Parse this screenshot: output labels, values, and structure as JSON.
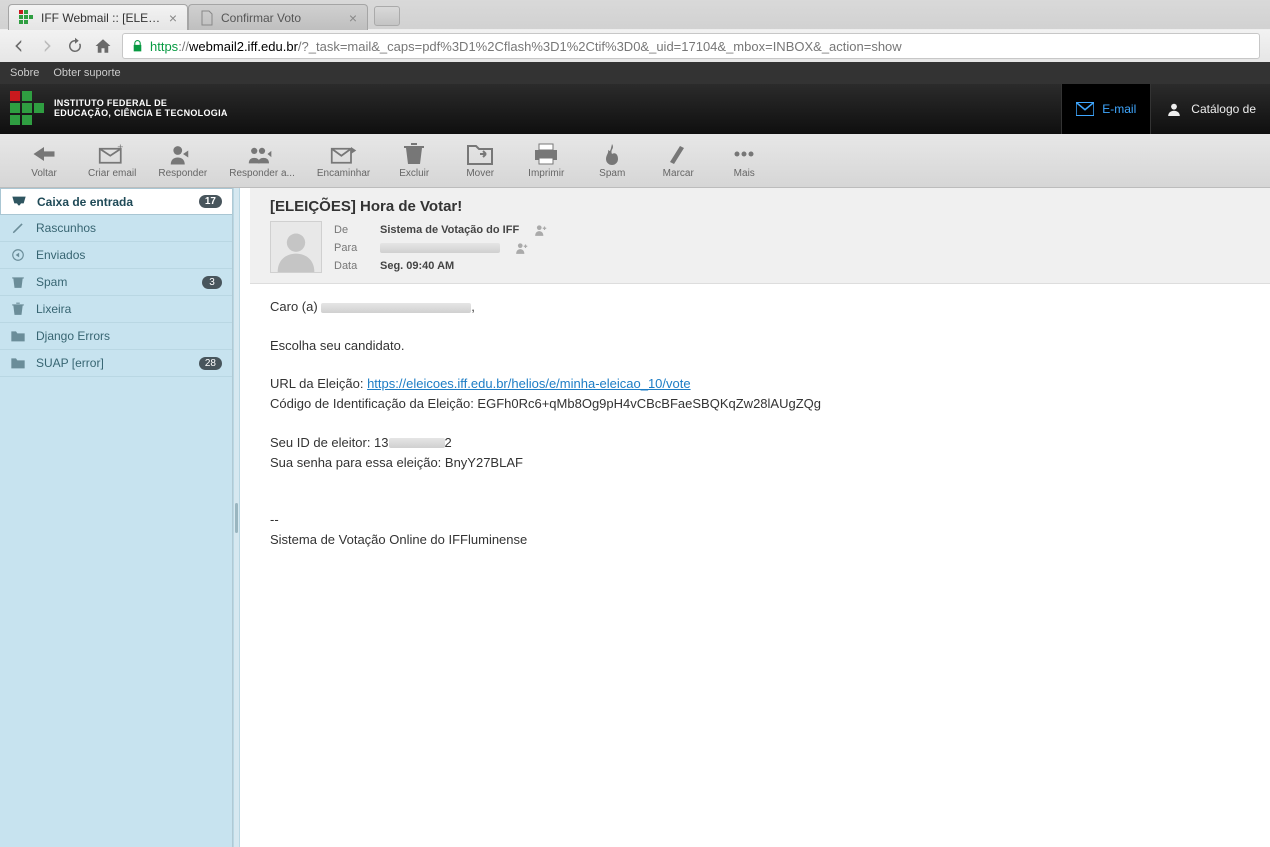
{
  "browser": {
    "tabs": [
      {
        "title": "IFF Webmail :: [ELE…",
        "active": true
      },
      {
        "title": "Confirmar Voto",
        "active": false
      }
    ],
    "url_https": "https",
    "url_sep": "://",
    "url_host": "webmail2.iff.edu.br",
    "url_path": "/?_task=mail&_caps=pdf%3D1%2Cflash%3D1%2Ctif%3D0&_uid=17104&_mbox=INBOX&_action=show"
  },
  "headerLinks": {
    "about": "Sobre",
    "support": "Obter suporte"
  },
  "logoText1": "INSTITUTO FEDERAL DE",
  "logoText2": "EDUCAÇÃO, CIÊNCIA E TECNOLOGIA",
  "rightNav": {
    "email": "E-mail",
    "catalog": "Catálogo de"
  },
  "toolbar": {
    "back": "Voltar",
    "compose": "Criar email",
    "reply": "Responder",
    "replyall": "Responder a...",
    "forward": "Encaminhar",
    "delete": "Excluir",
    "move": "Mover",
    "print": "Imprimir",
    "spam": "Spam",
    "mark": "Marcar",
    "more": "Mais"
  },
  "folders": [
    {
      "name": "Caixa de entrada",
      "badge": "17",
      "selected": true,
      "icon": "inbox"
    },
    {
      "name": "Rascunhos",
      "icon": "pencil"
    },
    {
      "name": "Enviados",
      "icon": "sent"
    },
    {
      "name": "Spam",
      "badge": "3",
      "icon": "spam"
    },
    {
      "name": "Lixeira",
      "icon": "trash"
    },
    {
      "name": "Django Errors",
      "icon": "folder"
    },
    {
      "name": "SUAP [error]",
      "badge": "28",
      "icon": "folder"
    }
  ],
  "message": {
    "subject": "[ELEIÇÕES] Hora de Votar!",
    "from_lbl": "De",
    "to_lbl": "Para",
    "date_lbl": "Data",
    "from": "Sistema de Votação do IFF",
    "date": "Seg. 09:40 AM",
    "l1a": "Caro (a) ",
    "l1b": ",",
    "l2": "Escolha seu candidato.",
    "l3": "URL da Eleição: ",
    "l3_link": "https://eleicoes.iff.edu.br/helios/e/minha-eleicao_10/vote",
    "l4": "Código de Identificação da Eleição: EGFh0Rc6+qMb8Og9pH4vCBcBFaeSBQKqZw28lAUgZQg",
    "l5a": "Seu ID de eleitor: 13",
    "l5b": "2",
    "l6": "Sua senha para essa eleição: BnyY27BLAF",
    "l7": "--",
    "l8": "Sistema de Votação Online do IFFluminense"
  }
}
